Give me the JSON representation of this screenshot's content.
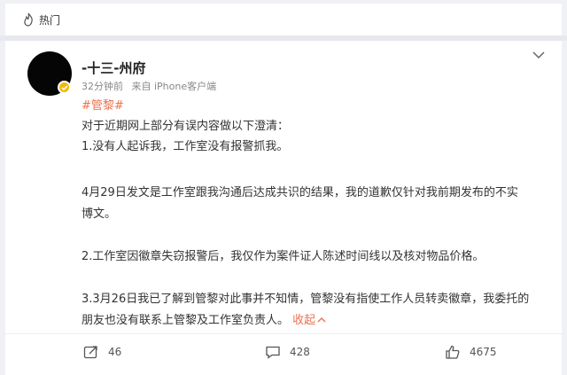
{
  "topbar": {
    "label": "热门",
    "icon": "flame-icon"
  },
  "post": {
    "username": "-十三-州府",
    "time": "32分钟前",
    "source": "来自 iPhone客户端",
    "hashtag": "#管黎#",
    "lines": [
      "对于近期网上部分有误内容做以下澄清：",
      "1.没有人起诉我，工作室没有报警抓我。",
      "4月29日发文是工作室跟我沟通后达成共识的结果，我的道歉仅针对我前期发布的不实",
      "博文。",
      "2.工作室因徽章失窃报警后，我仅作为案件证人陈述时间线以及核对物品价格。",
      "3.3月26日我已了解到管黎对此事并不知情，管黎没有指使工作人员转卖徽章，我委托的",
      "朋友也没有联系上管黎及工作室负责人。"
    ],
    "fold_label": "收起"
  },
  "actions": {
    "repost_count": "46",
    "comment_count": "428",
    "like_count": "4675"
  },
  "colors": {
    "accent": "#eb7350",
    "verified": "#f5b800"
  }
}
